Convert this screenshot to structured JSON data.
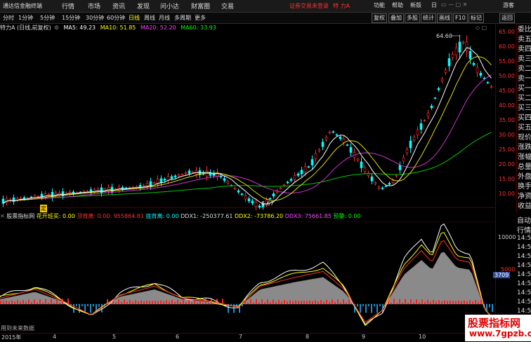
{
  "titlebar": {
    "app_name": "通达信金融终端",
    "menus": [
      "行情",
      "市场",
      "资讯",
      "发现",
      "问小达",
      "财富圈",
      "交易"
    ],
    "warning": "证券交易未登录",
    "stock": "特 力A",
    "right_menus": [
      "功能",
      "帮助",
      "新版",
      "日",
      "游客"
    ]
  },
  "toolbar": {
    "periods": [
      "分时",
      "1分钟",
      "5分钟",
      "15分钟",
      "30分钟",
      "60分钟",
      "日线",
      "周线",
      "月线",
      "多周期",
      "更多"
    ],
    "active_period": "日线",
    "right_buttons": [
      "复权",
      "叠加",
      "多股",
      "统计",
      "画线",
      "F10",
      "标记",
      "返回"
    ]
  },
  "main_chart": {
    "stock_label": "特力A (日线,前复权)",
    "ma5": "MA5: 49.23",
    "ma10": "MA10: 51.85",
    "ma20": "MA20: 52.20",
    "ma60": "MA60: 33.93",
    "high_label": "64.60",
    "low_label": "6.67",
    "marker": "定",
    "y_ticks": [
      "65.00",
      "60.00",
      "55.00",
      "50.00",
      "45.00",
      "40.00",
      "35.00",
      "30.00",
      "25.00",
      "20.00",
      "15.00",
      "10.00"
    ],
    "colors": {
      "ma5": "#ffffff",
      "ma10": "#ffff00",
      "ma20": "#ff44ff",
      "ma60": "#00ff00",
      "up": "#ff3030",
      "down": "#00ffff"
    }
  },
  "side_panel": {
    "items": [
      "委比",
      "卖五",
      "卖四",
      "卖三",
      "卖二",
      "卖一",
      "买一",
      "买二",
      "买三",
      "买四",
      "买五",
      "现价",
      "涨跌",
      "涨幅",
      "总量",
      "外盘",
      "换手",
      "净资",
      "收益"
    ]
  },
  "side_panel2": {
    "items": [
      "自动",
      "行情",
      "14:50",
      "14:50",
      "14:50",
      "14:50",
      "14:50",
      "14:50",
      "14:50",
      "14:50",
      "14:50"
    ]
  },
  "sub_chart": {
    "name": "股票指标网",
    "huajing": "花开班买: 0.00",
    "dingbeili": "顶背离: 0.00",
    "v955": ": 955864.81",
    "dibeili": "底背离: 0.00",
    "ddx1": "DDX1: -250377.61",
    "ddx2": "DDX2: -73786.20",
    "ddx3": "DDX3: 75661.85",
    "yujing": "预警: 0.00",
    "y_ticks": [
      "10000",
      "5000",
      "3709"
    ],
    "bottom_text": "用到未来数据"
  },
  "x_axis": [
    "2015年",
    "4",
    "5",
    "6",
    "7",
    "8",
    "9",
    "10"
  ],
  "watermark": {
    "line1": "股票指标网",
    "line2": "www.7gpzb.com"
  }
}
